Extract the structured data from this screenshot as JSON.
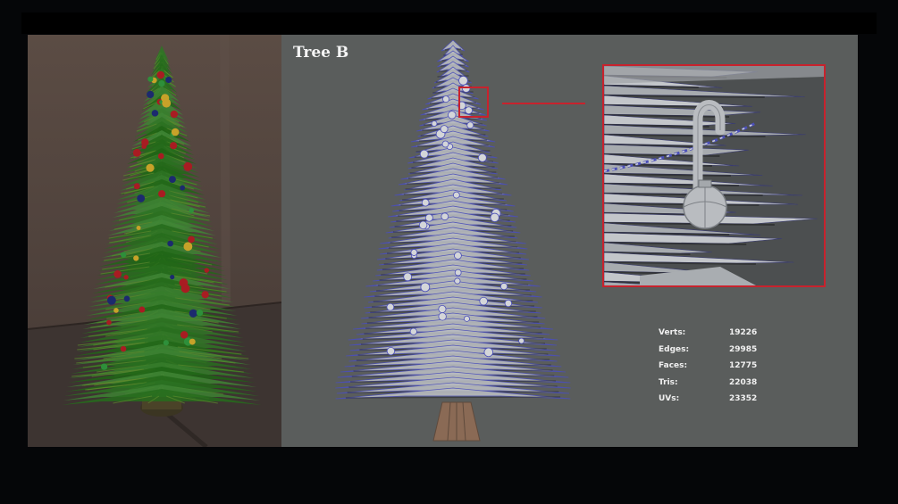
{
  "title": "Tree B",
  "stats": [
    {
      "label": "Verts:",
      "value": "19226"
    },
    {
      "label": "Edges:",
      "value": "29985"
    },
    {
      "label": "Faces:",
      "value": "12775"
    },
    {
      "label": "Tris:",
      "value": "22038"
    },
    {
      "label": "UVs:",
      "value": "23352"
    }
  ],
  "colors": {
    "highlight": "#c8222d",
    "wire": "#4b4fb8",
    "mesh": "#b9bcc0",
    "foliage": "#3d6a1f",
    "pot": "#7a5a45",
    "ornament_red": "#a81c22",
    "ornament_green": "#2e8f3a",
    "ornament_blue": "#1c2a6e",
    "ornament_gold": "#c7a229"
  },
  "icons": {
    "render_view": "textured-tree-render",
    "viewport_view": "wireframe-tree-mesh",
    "zoom_view": "candy-cane-closeup"
  }
}
